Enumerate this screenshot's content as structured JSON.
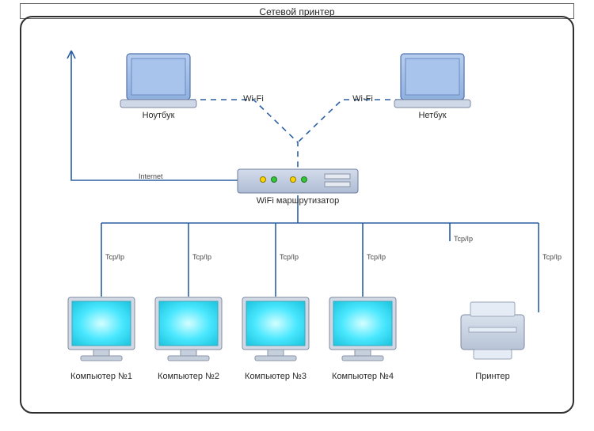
{
  "title": "Сетевой принтер",
  "devices": {
    "laptop_top_left": {
      "label": "Ноутбук"
    },
    "laptop_top_right": {
      "label": "Нетбук"
    },
    "router": {
      "label": "WiFi маршрутизатор"
    },
    "pc1": {
      "label": "Компьютер №1"
    },
    "pc2": {
      "label": "Компьютер №2"
    },
    "pc3": {
      "label": "Компьютер №3"
    },
    "pc4": {
      "label": "Компьютер №4"
    },
    "printer": {
      "label": "Принтер"
    }
  },
  "links": {
    "wifi_left": "Wi-Fi",
    "wifi_right": "Wi-Fi",
    "internet": "Internet",
    "tcpip": "Tcp/Ip"
  },
  "colors": {
    "wire": "#2b5fa4",
    "dash": "#2b5fa4",
    "laptop_fill": "#9fbde6",
    "laptop_stroke": "#3b64a8",
    "monitor_fill": "#40e0f8",
    "monitor_glow": "#c8fbff",
    "printer_fill": "#c5d0e0",
    "router_fill": "#c0cbe0"
  }
}
